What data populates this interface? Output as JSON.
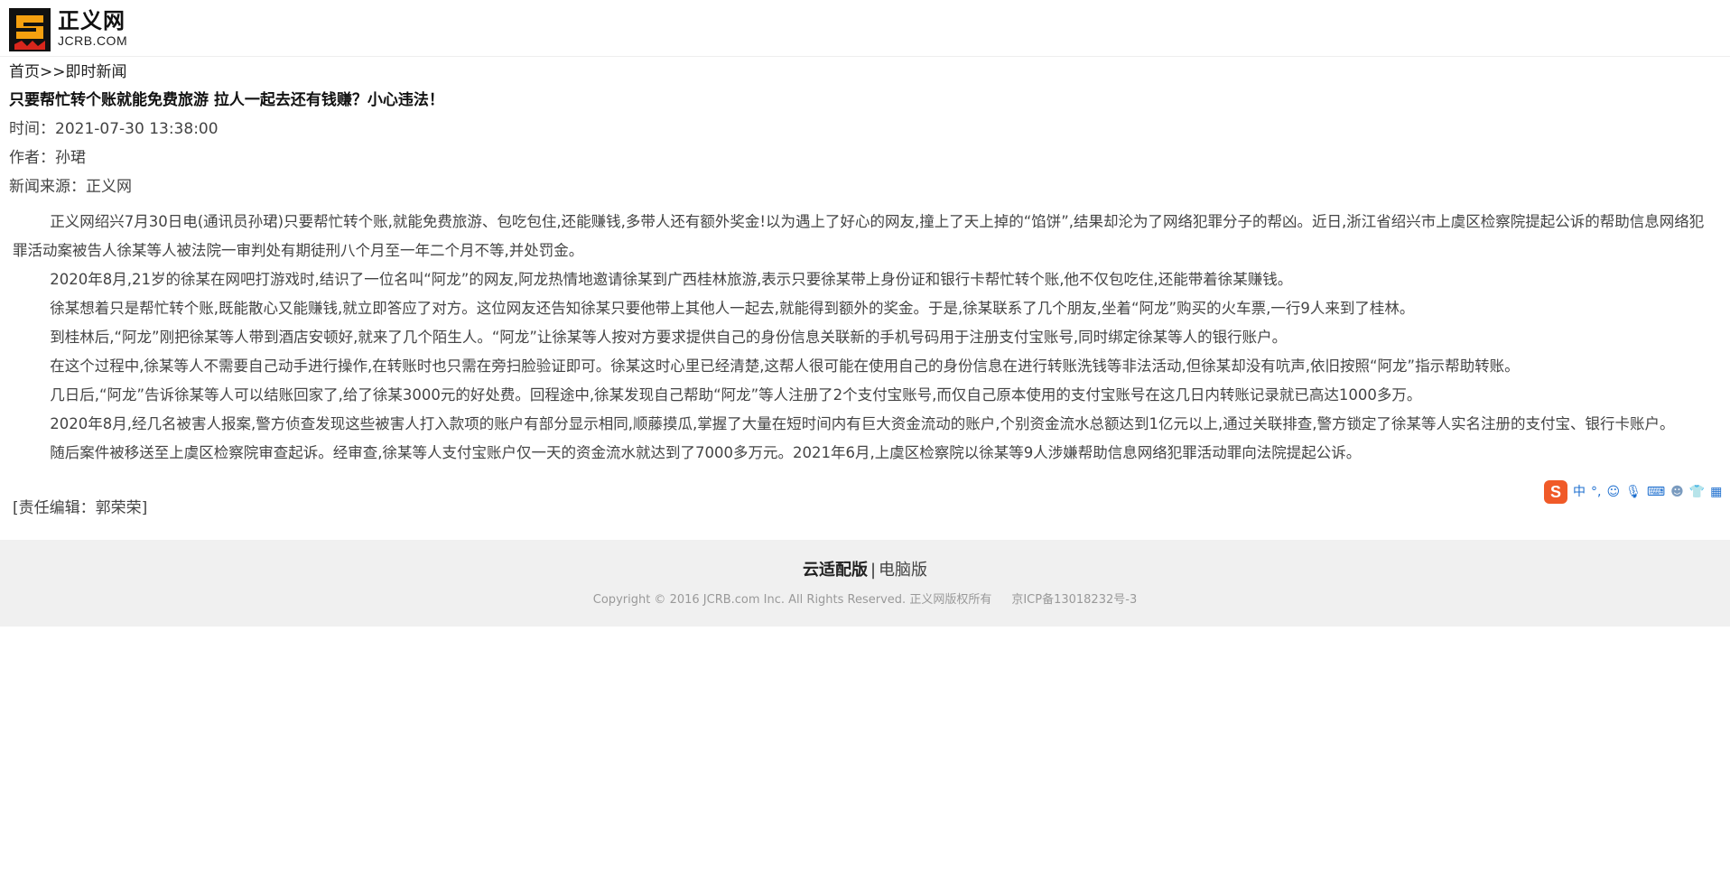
{
  "header": {
    "logo_cn": "正义网",
    "logo_en": "JCRB.COM"
  },
  "breadcrumb": {
    "home": "首页",
    "separator": ">>",
    "section": "即时新闻"
  },
  "article": {
    "title": "只要帮忙转个账就能免费旅游 拉人一起去还有钱赚？小心违法！",
    "time": "时间：2021-07-30 13:38:00",
    "author": "作者：孙珺",
    "source": "新闻来源：正义网",
    "paragraphs": [
      "正义网绍兴7月30日电(通讯员孙珺)只要帮忙转个账,就能免费旅游、包吃包住,还能赚钱,多带人还有额外奖金!以为遇上了好心的网友,撞上了天上掉的“馅饼”,结果却沦为了网络犯罪分子的帮凶。近日,浙江省绍兴市上虞区检察院提起公诉的帮助信息网络犯罪活动案被告人徐某等人被法院一审判处有期徒刑八个月至一年二个月不等,并处罚金。",
      "2020年8月,21岁的徐某在网吧打游戏时,结识了一位名叫“阿龙”的网友,阿龙热情地邀请徐某到广西桂林旅游,表示只要徐某带上身份证和银行卡帮忙转个账,他不仅包吃住,还能带着徐某赚钱。",
      "徐某想着只是帮忙转个账,既能散心又能赚钱,就立即答应了对方。这位网友还告知徐某只要他带上其他人一起去,就能得到额外的奖金。于是,徐某联系了几个朋友,坐着“阿龙”购买的火车票,一行9人来到了桂林。",
      "到桂林后,“阿龙”刚把徐某等人带到酒店安顿好,就来了几个陌生人。“阿龙”让徐某等人按对方要求提供自己的身份信息关联新的手机号码用于注册支付宝账号,同时绑定徐某等人的银行账户。",
      "在这个过程中,徐某等人不需要自己动手进行操作,在转账时也只需在旁扫脸验证即可。徐某这时心里已经清楚,这帮人很可能在使用自己的身份信息在进行转账洗钱等非法活动,但徐某却没有吭声,依旧按照“阿龙”指示帮助转账。",
      "几日后,“阿龙”告诉徐某等人可以结账回家了,给了徐某3000元的好处费。回程途中,徐某发现自己帮助“阿龙”等人注册了2个支付宝账号,而仅自己原本使用的支付宝账号在这几日内转账记录就已高达1000多万。",
      "2020年8月,经几名被害人报案,警方侦查发现这些被害人打入款项的账户有部分显示相同,顺藤摸瓜,掌握了大量在短时间内有巨大资金流动的账户,个别资金流水总额达到1亿元以上,通过关联排查,警方锁定了徐某等人实名注册的支付宝、银行卡账户。",
      "随后案件被移送至上虞区检察院审查起诉。经审查,徐某等人支付宝账户仅一天的资金流水就达到了7000多万元。2021年6月,上虞区检察院以徐某等9人涉嫌帮助信息网络犯罪活动罪向法院提起公诉。"
    ],
    "editor": "[责任编辑：郭荣荣]"
  },
  "ime_toolbar": {
    "logo": "S",
    "mode": "中",
    "punct": "°,",
    "icons": [
      "emoji-icon",
      "microphone-icon",
      "keyboard-icon",
      "user-icon",
      "shirt-icon",
      "grid-icon"
    ]
  },
  "footer": {
    "cloud_version": "云适配版",
    "divider": "|",
    "pc_version": "电脑版",
    "copyright": "Copyright © 2016 JCRB.com Inc. All Rights Reserved. 正义网版权所有",
    "icp": "京ICP备13018232号-3"
  },
  "colors": {
    "logo_orange": "#f5a00f",
    "logo_red": "#d8261c",
    "ime_orange": "#f05a28",
    "footer_bg": "#f0f0f0"
  }
}
